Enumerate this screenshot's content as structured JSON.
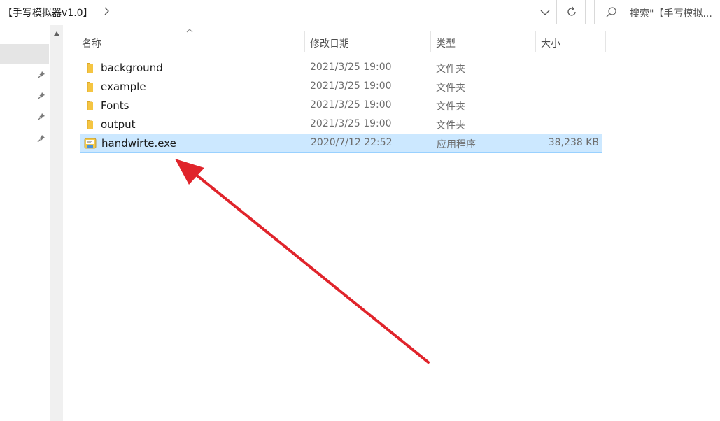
{
  "address": {
    "breadcrumb": "【手写模拟器v1.0】",
    "search_placeholder": "搜索\"【手写模拟..."
  },
  "columns": {
    "name": "名称",
    "date": "修改日期",
    "type": "类型",
    "size": "大小"
  },
  "files": [
    {
      "name": "background",
      "date": "2021/3/25 19:00",
      "type": "文件夹",
      "size": "",
      "icon": "folder-icon"
    },
    {
      "name": "example",
      "date": "2021/3/25 19:00",
      "type": "文件夹",
      "size": "",
      "icon": "folder-icon"
    },
    {
      "name": "Fonts",
      "date": "2021/3/25 19:00",
      "type": "文件夹",
      "size": "",
      "icon": "folder-icon"
    },
    {
      "name": "output",
      "date": "2021/3/25 19:00",
      "type": "文件夹",
      "size": "",
      "icon": "folder-icon"
    },
    {
      "name": "handwirte.exe",
      "date": "2020/7/12 22:52",
      "type": "应用程序",
      "size": "38,238 KB",
      "icon": "application-icon",
      "selected": true
    }
  ],
  "colors": {
    "selection_bg": "#cce8ff",
    "selection_border": "#99d1ff",
    "annotation_arrow": "#e0242b",
    "folder": "#f5c542"
  }
}
